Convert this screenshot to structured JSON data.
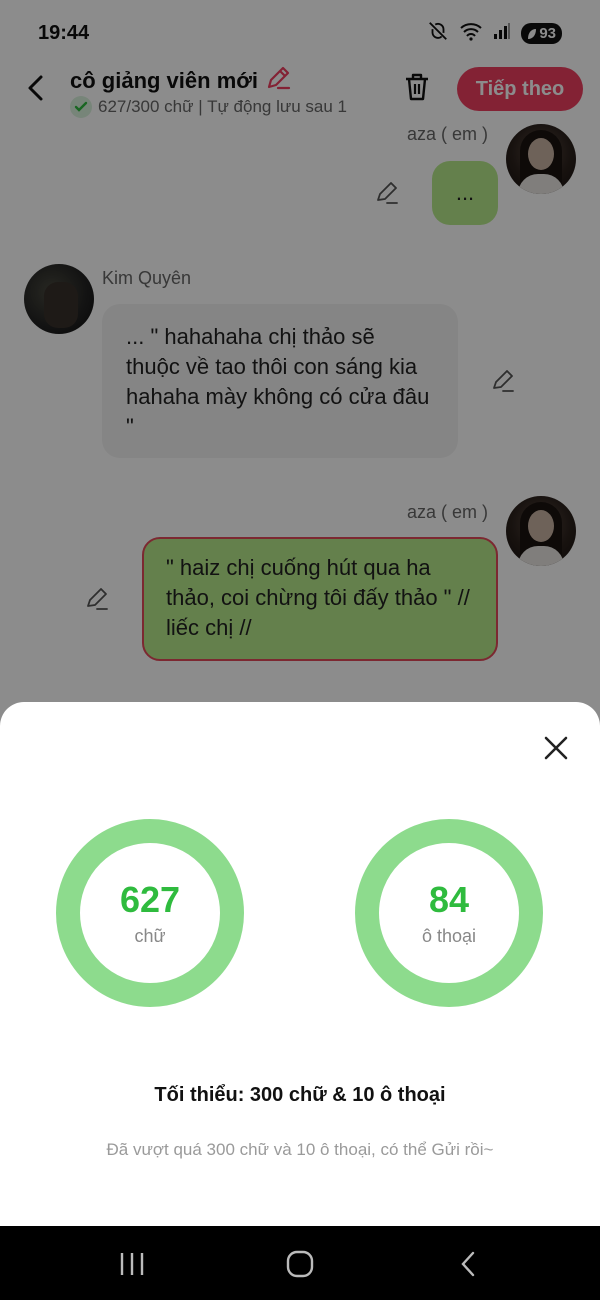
{
  "status_bar": {
    "time": "19:44",
    "battery": "93"
  },
  "header": {
    "title": "cô giảng viên mới",
    "subtitle": "627/300 chữ | Tự động lưu sau 1",
    "next_label": "Tiếp theo"
  },
  "messages": [
    {
      "sender": "aza ( em )",
      "text": "...",
      "side": "right"
    },
    {
      "sender": "Kim Quyên",
      "text": "... \" hahahaha chị thảo sẽ thuộc về tao thôi con sáng kia hahaha mày không có cửa đâu \"",
      "side": "left"
    },
    {
      "sender": "aza ( em )",
      "text": "\" haiz chị cuống hút qua ha thảo, coi chừng tôi đấy thảo \" // liếc chị //",
      "side": "right"
    }
  ],
  "stats": {
    "words_value": "627",
    "words_label": "chữ",
    "dialogs_value": "84",
    "dialogs_label": "ô thoại",
    "minimum": "Tối thiểu: 300 chữ & 10 ô thoại",
    "hint": "Đã vượt quá 300 chữ và 10 ô thoại, có thể Gửi rồi~"
  },
  "colors": {
    "accent": "#ee3f60",
    "ring": "#8ddb8d",
    "ring_text": "#2fbb3e",
    "bubble_green": "#b6ea8a",
    "bubble_gray": "#f3f3f3"
  },
  "icons": [
    "back-arrow-icon",
    "edit-pencil-icon",
    "check-icon",
    "trash-icon",
    "close-icon",
    "recents-icon",
    "home-icon",
    "back-nav-icon"
  ]
}
